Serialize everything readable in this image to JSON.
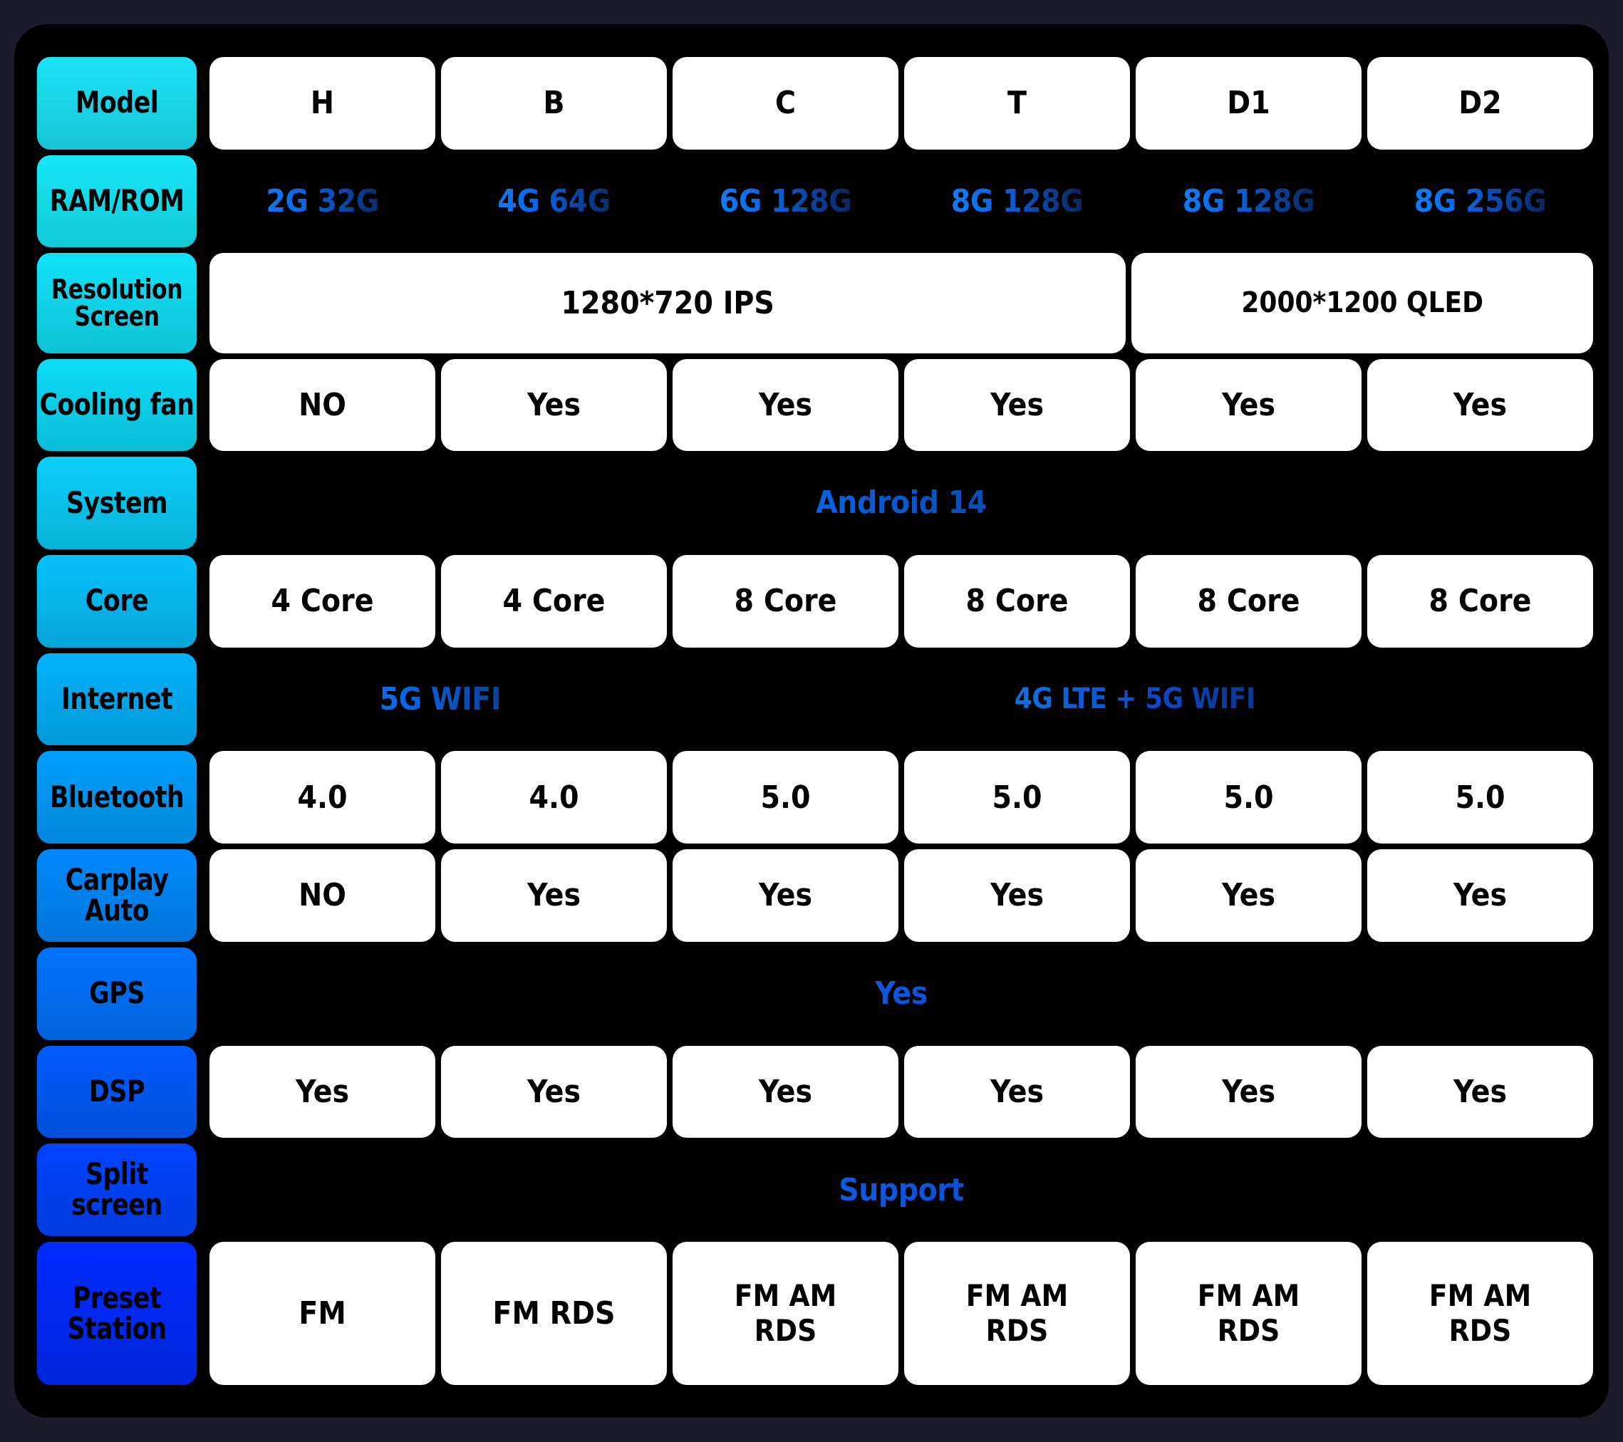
{
  "meta": {
    "background_color": "#1b1b2b",
    "frame_color": "#000000",
    "cell_color": "#ffffff",
    "label_gradient_start": "#00e5ff",
    "label_gradient_end": "#0b3bf5",
    "value_accent_color": "#1e90ff"
  },
  "columns": [
    "H",
    "B",
    "C",
    "T",
    "D1",
    "D2"
  ],
  "rows": [
    {
      "label": "Model",
      "label_color": "#1ce4f7",
      "cells": [
        {
          "text": "H",
          "span": 1,
          "style": "plain"
        },
        {
          "text": "B",
          "span": 1,
          "style": "plain"
        },
        {
          "text": "C",
          "span": 1,
          "style": "plain"
        },
        {
          "text": "T",
          "span": 1,
          "style": "plain"
        },
        {
          "text": "D1",
          "span": 1,
          "style": "plain"
        },
        {
          "text": "D2",
          "span": 1,
          "style": "plain"
        }
      ]
    },
    {
      "label": "RAM/ROM",
      "label_color": "#16e8f8",
      "cells": [
        {
          "text": "2G 32G",
          "span": 1,
          "style": "gradient"
        },
        {
          "text": "4G 64G",
          "span": 1,
          "style": "gradient"
        },
        {
          "text": "6G 128G",
          "span": 1,
          "style": "gradient"
        },
        {
          "text": "8G 128G",
          "span": 1,
          "style": "gradient"
        },
        {
          "text": "8G 128G",
          "span": 1,
          "style": "gradient"
        },
        {
          "text": "8G 256G",
          "span": 1,
          "style": "gradient"
        }
      ]
    },
    {
      "label": "Resolution\nScreen",
      "label_color": "#11e2f8",
      "cells": [
        {
          "text": "1280*720 IPS",
          "span": 4,
          "style": "plain"
        },
        {
          "text": "2000*1200 QLED",
          "span": 2,
          "style": "plain"
        }
      ]
    },
    {
      "label": "Cooling fan",
      "label_color": "#0ddcf9",
      "cells": [
        {
          "text": "NO",
          "span": 1,
          "style": "plain"
        },
        {
          "text": "Yes",
          "span": 1,
          "style": "plain"
        },
        {
          "text": "Yes",
          "span": 1,
          "style": "plain"
        },
        {
          "text": "Yes",
          "span": 1,
          "style": "plain"
        },
        {
          "text": "Yes",
          "span": 1,
          "style": "plain"
        },
        {
          "text": "Yes",
          "span": 1,
          "style": "plain"
        }
      ]
    },
    {
      "label": "System",
      "label_color": "#0bcffa",
      "cells": [
        {
          "text": "Android 14",
          "span": 6,
          "style": "gradient"
        }
      ]
    },
    {
      "label": "Core",
      "label_color": "#07c1fb",
      "cells": [
        {
          "text": "4 Core",
          "span": 1,
          "style": "plain"
        },
        {
          "text": "4 Core",
          "span": 1,
          "style": "plain"
        },
        {
          "text": "8 Core",
          "span": 1,
          "style": "plain"
        },
        {
          "text": "8 Core",
          "span": 1,
          "style": "plain"
        },
        {
          "text": "8 Core",
          "span": 1,
          "style": "plain"
        },
        {
          "text": "8 Core",
          "span": 1,
          "style": "plain"
        }
      ]
    },
    {
      "label": "Internet",
      "label_color": "#04b2fc",
      "cells": [
        {
          "text": "5G WIFI",
          "span": 2,
          "style": "gradient"
        },
        {
          "text": "4G LTE + 5G WIFI",
          "span": 4,
          "style": "gradient-cyan"
        }
      ]
    },
    {
      "label": "Bluetooth",
      "label_color": "#029efd",
      "cells": [
        {
          "text": "4.0",
          "span": 1,
          "style": "plain"
        },
        {
          "text": "4.0",
          "span": 1,
          "style": "plain"
        },
        {
          "text": "5.0",
          "span": 1,
          "style": "plain"
        },
        {
          "text": "5.0",
          "span": 1,
          "style": "plain"
        },
        {
          "text": "5.0",
          "span": 1,
          "style": "plain"
        },
        {
          "text": "5.0",
          "span": 1,
          "style": "plain"
        }
      ]
    },
    {
      "label": "Carplay Auto",
      "label_color": "#0189fd",
      "cells": [
        {
          "text": "NO",
          "span": 1,
          "style": "plain"
        },
        {
          "text": "Yes",
          "span": 1,
          "style": "plain"
        },
        {
          "text": "Yes",
          "span": 1,
          "style": "plain"
        },
        {
          "text": "Yes",
          "span": 1,
          "style": "plain"
        },
        {
          "text": "Yes",
          "span": 1,
          "style": "plain"
        },
        {
          "text": "Yes",
          "span": 1,
          "style": "plain"
        }
      ]
    },
    {
      "label": "GPS",
      "label_color": "#0173fe",
      "cells": [
        {
          "text": "Yes",
          "span": 6,
          "style": "gradient-short"
        }
      ]
    },
    {
      "label": "DSP",
      "label_color": "#015cfe",
      "cells": [
        {
          "text": "Yes",
          "span": 1,
          "style": "plain"
        },
        {
          "text": "Yes",
          "span": 1,
          "style": "plain"
        },
        {
          "text": "Yes",
          "span": 1,
          "style": "plain"
        },
        {
          "text": "Yes",
          "span": 1,
          "style": "plain"
        },
        {
          "text": "Yes",
          "span": 1,
          "style": "plain"
        },
        {
          "text": "Yes",
          "span": 1,
          "style": "plain"
        }
      ]
    },
    {
      "label": "Split screen",
      "label_color": "#0144ff",
      "cells": [
        {
          "text": "Support",
          "span": 6,
          "style": "gradient-short"
        }
      ]
    },
    {
      "label": "Preset Station",
      "label_color": "#012bff",
      "cells": [
        {
          "text": "FM",
          "span": 1,
          "style": "plain"
        },
        {
          "text": "FM RDS",
          "span": 1,
          "style": "plain"
        },
        {
          "text": "FM AM\nRDS",
          "span": 1,
          "style": "two-line"
        },
        {
          "text": "FM AM\nRDS",
          "span": 1,
          "style": "two-line"
        },
        {
          "text": "FM AM\nRDS",
          "span": 1,
          "style": "two-line"
        },
        {
          "text": "FM AM\nRDS",
          "span": 1,
          "style": "two-line"
        }
      ]
    }
  ]
}
